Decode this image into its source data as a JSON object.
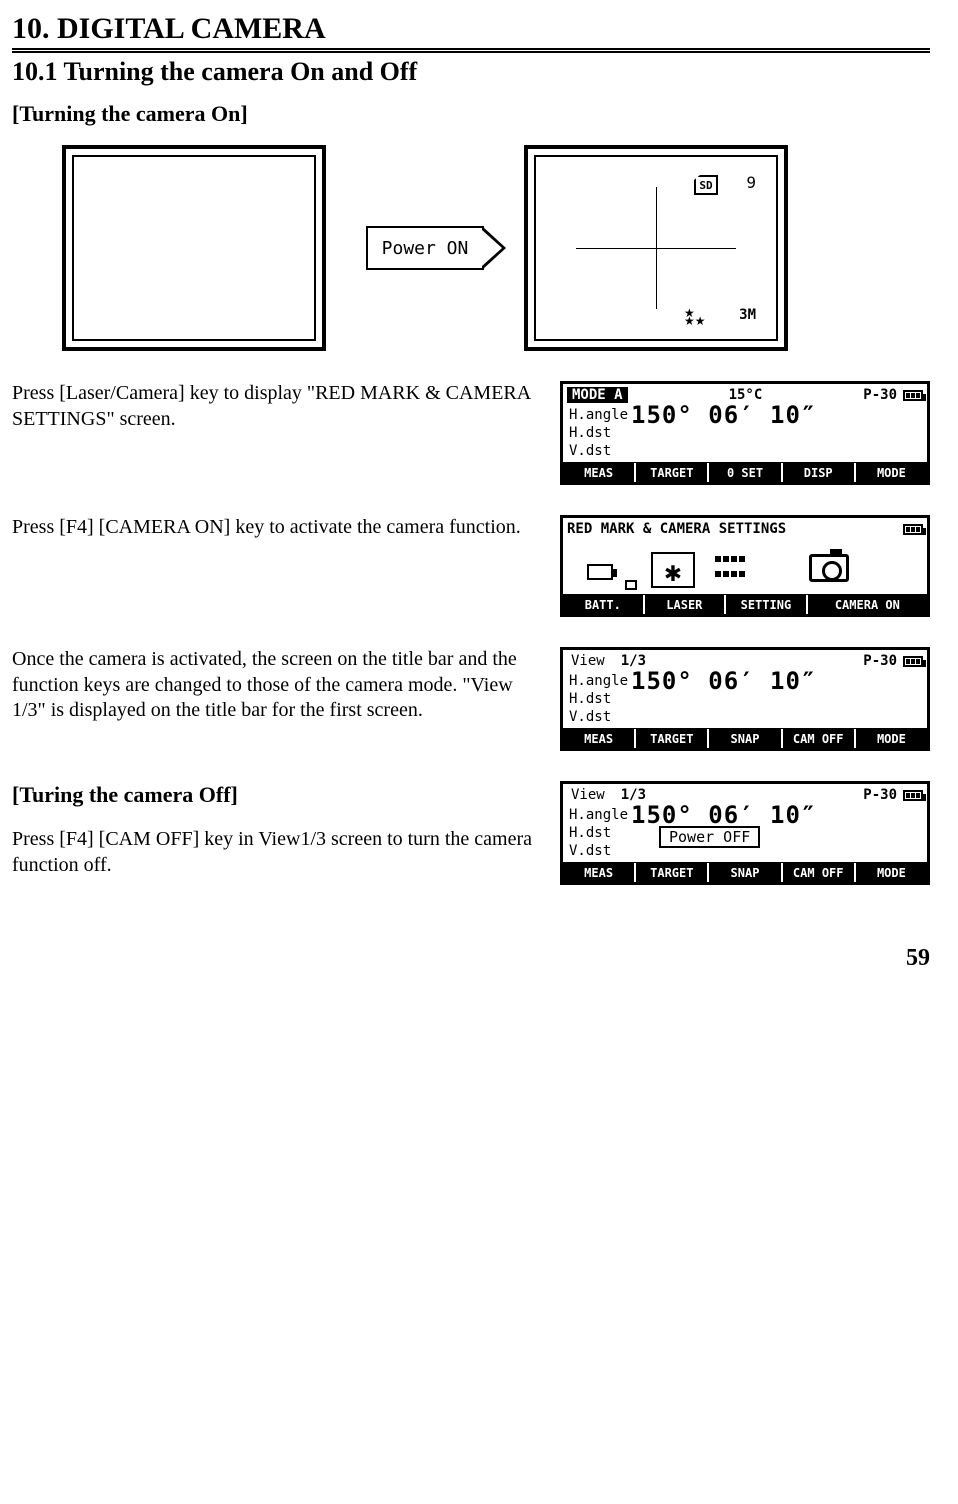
{
  "chapter": "10. DIGITAL CAMERA",
  "section": "10.1 Turning the camera On and Off",
  "sub_on": "[Turning the camera On]",
  "sub_off": "[Turing the camera Off]",
  "arrow_label": "Power ON",
  "sd_label": "SD",
  "count_label": "9",
  "res_label": "3M",
  "para1": "Press [Laser/Camera] key to display \"RED MARK & CAMERA SETTINGS\" screen.",
  "para2": "Press [F4] [CAMERA ON] key to activate the camera function.",
  "para3": "Once the camera is activated, the screen on the title bar and the function keys are changed to those of the camera mode. \"View 1/3\"  is displayed on the title bar for the first screen.",
  "para4": "Press [F4] [CAM OFF] key in View1/3 screen to turn the camera function off.",
  "lcd1": {
    "title_left": "MODE A",
    "title_mid": "15°C",
    "title_right": "P-30",
    "rows": [
      "H.angle",
      "H.dst",
      "V.dst"
    ],
    "reading": "150° 06′ 10″",
    "tabs": [
      "MEAS",
      "TARGET",
      "0 SET",
      "DISP",
      "MODE"
    ]
  },
  "lcd2": {
    "title": "RED MARK & CAMERA SETTINGS",
    "tabs": [
      "BATT.",
      "LASER",
      "SETTING",
      "CAMERA ON"
    ]
  },
  "lcd3": {
    "title_left": "View",
    "title_mid": "1/3",
    "title_right": "P-30",
    "rows": [
      "H.angle",
      "H.dst",
      "V.dst"
    ],
    "reading": "150° 06′ 10″",
    "tabs": [
      "MEAS",
      "TARGET",
      "SNAP",
      "CAM OFF",
      "MODE"
    ]
  },
  "lcd4": {
    "title_left": "View",
    "title_mid": "1/3",
    "title_right": "P-30",
    "rows": [
      "H.angle",
      "H.dst",
      "V.dst"
    ],
    "reading": "150° 06′ 10″",
    "overlay": "Power OFF",
    "tabs": [
      "MEAS",
      "TARGET",
      "SNAP",
      "CAM OFF",
      "MODE"
    ]
  },
  "page_num": "59"
}
